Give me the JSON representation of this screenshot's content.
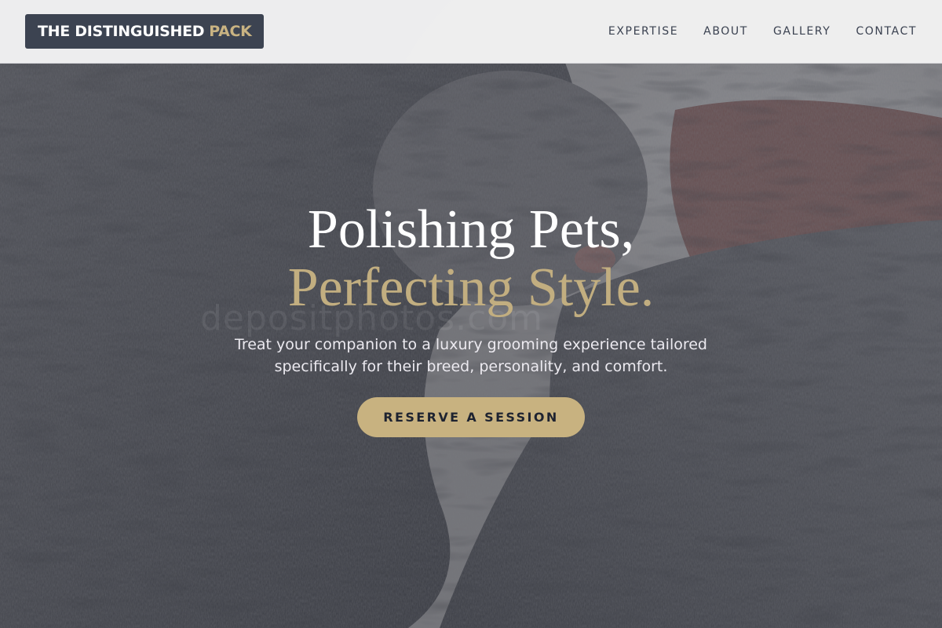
{
  "header": {
    "logo": {
      "main": "THE DISTINGUISHED",
      "accent": "PACK"
    },
    "nav": [
      {
        "label": "EXPERTISE"
      },
      {
        "label": "ABOUT"
      },
      {
        "label": "GALLERY"
      },
      {
        "label": "CONTACT"
      }
    ]
  },
  "hero": {
    "title_line1": "Polishing Pets,",
    "title_line2": "Perfecting Style.",
    "subtitle": "Treat your companion to a luxury grooming experience tailored specifically for their breed, personality, and comfort.",
    "cta_label": "RESERVE A SESSION",
    "watermark": "depositphotos.com",
    "background_image": "two-tabby-cats-cuddling-photo"
  },
  "colors": {
    "accent_gold": "#c8b280",
    "logo_bg": "#3c4351",
    "nav_text": "#3a4150",
    "header_bg": "#f2f2f3"
  }
}
